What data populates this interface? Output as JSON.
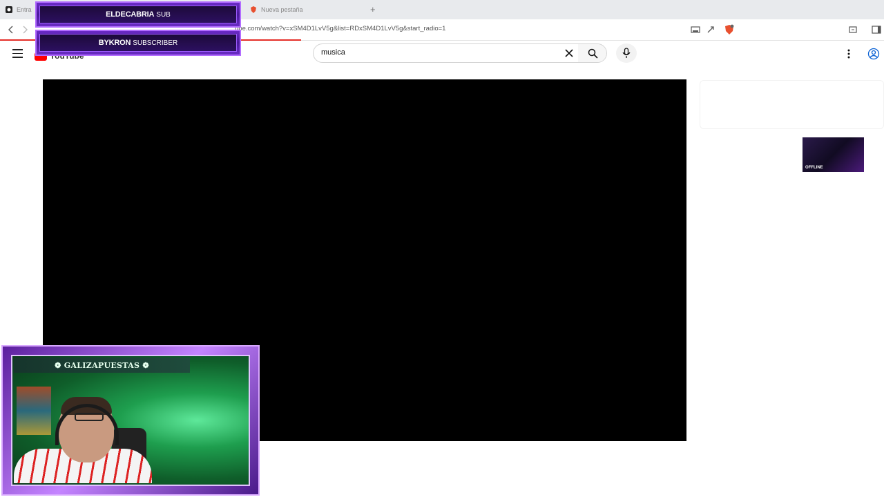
{
  "browser": {
    "tabs": [
      {
        "label": "Entra"
      },
      {
        "label": "Nueva pestaña"
      }
    ],
    "new_tab": "+",
    "url": "ube.com/watch?v=xSM4D1LvV5g&list=RDxSM4D1LvV5g&start_radio=1"
  },
  "youtube": {
    "logo_text": "YouTube",
    "search": {
      "value": "musica"
    }
  },
  "overlay": {
    "alerts": [
      {
        "name": "ELDECABRIA",
        "type": "SUB"
      },
      {
        "name": "BYKRON",
        "type": "SUBSCRIBER"
      }
    ],
    "webcam_banner": "❁ GALIZAPUESTAS ❁"
  },
  "sidebar": {
    "thumb_label": "OFFLINE"
  },
  "colors": {
    "alert_purple": "#6a2bc4",
    "progress_red": "#e52d27",
    "player_bg": "#000000"
  }
}
